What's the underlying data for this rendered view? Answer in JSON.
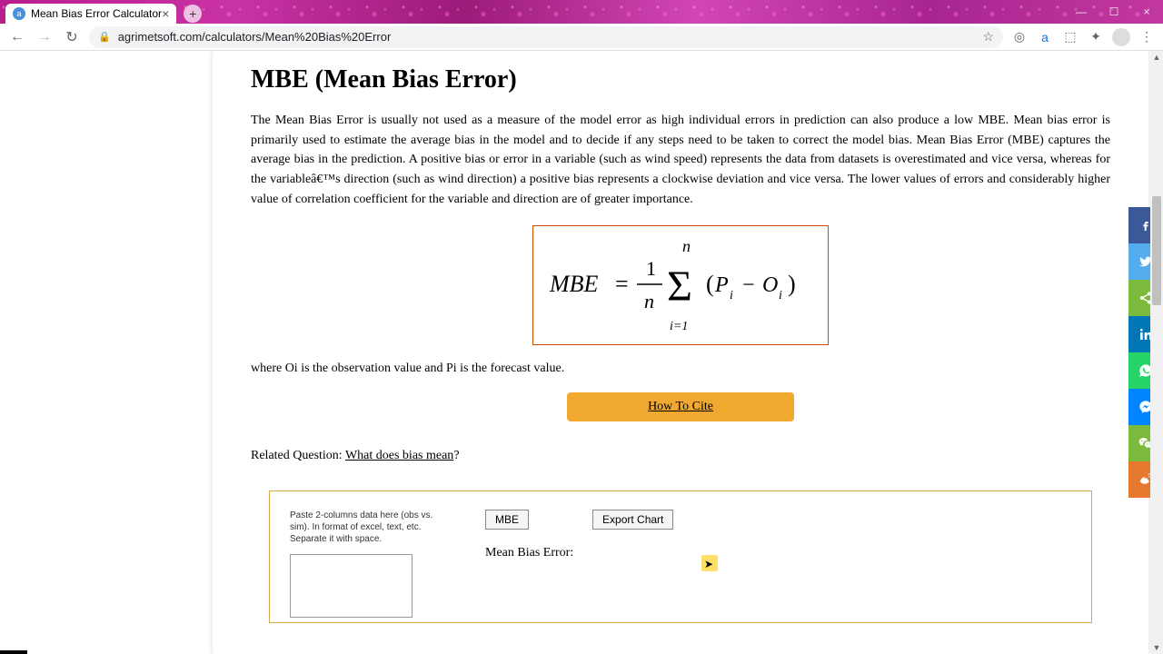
{
  "browser": {
    "tab_title": "Mean Bias Error Calculator",
    "url": "agrimetsoft.com/calculators/Mean%20Bias%20Error",
    "new_tab_symbol": "+",
    "close_symbol": "×",
    "minimize": "—",
    "maximize": "☐",
    "close_win": "×",
    "back": "←",
    "forward": "→",
    "reload": "↻",
    "lock": "🔒",
    "star": "☆",
    "menu": "⋮"
  },
  "page": {
    "title": "MBE (Mean Bias Error)",
    "body": "The Mean Bias Error is usually not used as a measure of the model error as high individual errors in prediction can also produce a low MBE. Mean bias error is primarily used to estimate the average bias in the model and to decide if any steps need to be taken to correct the model bias. Mean Bias Error (MBE) captures the average bias in the prediction. A positive bias or error in a variable (such as wind speed) represents the data from datasets is overestimated and vice versa, whereas for the variableâ€™s direction (such as wind direction) a positive bias represents a clockwise deviation and vice versa. The lower values of errors and considerably higher value of correlation coefficient for the variable and direction are of greater importance.",
    "after_formula": "where Oi is the observation value and Pi is the forecast value.",
    "cite_button": "How To Cite",
    "related_label": "Related Question: ",
    "related_link": "What does bias mean",
    "related_suffix": "?"
  },
  "calc": {
    "instructions": "Paste 2-columns data here (obs vs. sim). In format of excel, text, etc. Separate it with space.",
    "mbe_button": "MBE",
    "export_button": "Export Chart",
    "result_label": "Mean Bias Error:"
  },
  "share": {
    "fb": "f",
    "tw": "t",
    "sh": "s",
    "li": "in",
    "wa": "w",
    "ms": "m",
    "wc": "c",
    "wb": "b"
  }
}
